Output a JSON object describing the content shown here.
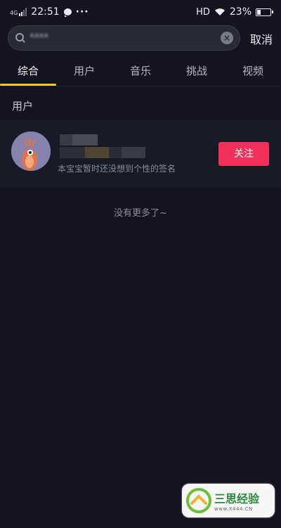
{
  "status_bar": {
    "network": "4G",
    "time": "22:51",
    "more": "···",
    "hd": "HD",
    "battery": "23%"
  },
  "search": {
    "query": "ᴿᴿᴿᴿ"
  },
  "cancel_label": "取消",
  "tabs": [
    {
      "label": "综合",
      "active": true
    },
    {
      "label": "用户"
    },
    {
      "label": "音乐"
    },
    {
      "label": "挑战"
    },
    {
      "label": "视频"
    }
  ],
  "section_title": "用户",
  "user": {
    "bio": "本宝宝暂时还没想到个性的签名",
    "follow_label": "关注"
  },
  "end_text": "没有更多了~",
  "watermark": {
    "title": "三思经验",
    "url": "www.X444.CN"
  }
}
